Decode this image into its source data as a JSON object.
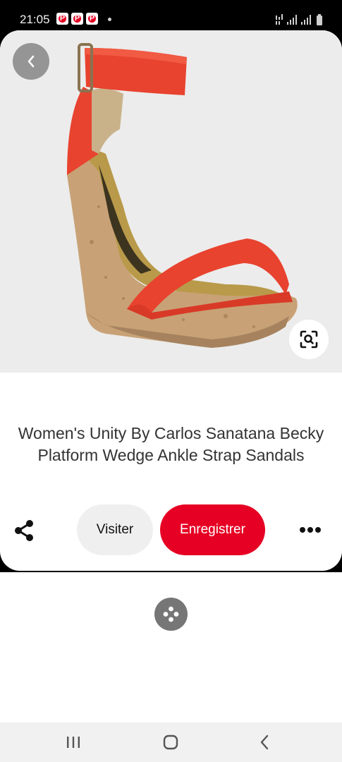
{
  "status_bar": {
    "time": "21:05",
    "notification_badges": [
      "P",
      "P",
      "P"
    ]
  },
  "pin": {
    "title": "Women's Unity By Carlos Sanatana Becky Platform Wedge Ankle Strap Sandals",
    "image_description_icon": "red-cork-wedge-sandal-image"
  },
  "actions": {
    "visit_label": "Visiter",
    "save_label": "Enregistrer"
  },
  "colors": {
    "brand_red": "#e60023",
    "visit_bg": "#efefef"
  }
}
